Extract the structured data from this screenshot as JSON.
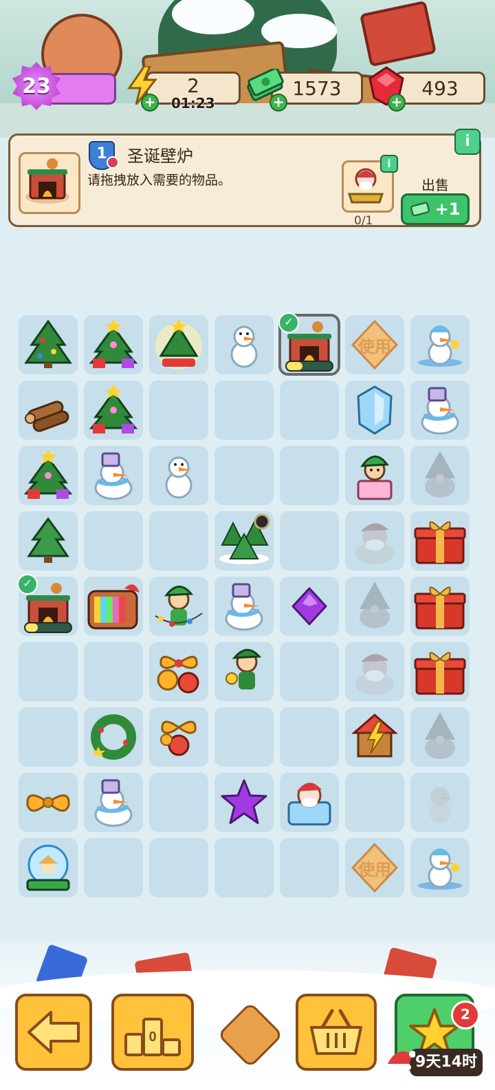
{
  "hud": {
    "level": "23",
    "energy": "2",
    "energy_timer": "01:23",
    "cash": "1573",
    "gems": "493"
  },
  "info_panel": {
    "rank": "1",
    "title": "圣诞壁炉",
    "description": "请拖拽放入需要的物品。",
    "requirement_count": "0/1",
    "sell_label": "出售",
    "sell_value": "+1",
    "info_glyph": "i"
  },
  "board": {
    "cols": 7,
    "rows": 9,
    "cells": [
      [
        "tree-decorated",
        "tree-star-gifts",
        "tree-star-glowing",
        "snowman-small",
        "fireplace-building",
        "use-token",
        "snowman-ski"
      ],
      [
        "logs",
        "tree-star-gifts",
        "empty",
        "empty",
        "empty",
        "ice-crystal",
        "snowman-bucket"
      ],
      [
        "tree-star-gifts",
        "snowman-bucket",
        "snowman-small",
        "empty",
        "empty",
        "elf-gift",
        "gnome-ghost"
      ],
      [
        "pine-tree",
        "empty",
        "empty",
        "snowy-pines",
        "empty",
        "santa-ghost",
        "gift-box-red"
      ],
      [
        "fireplace-building",
        "retro-tv",
        "elf-lights",
        "snowman-bucket",
        "purple-gem",
        "gnome-ghost",
        "gift-box-red"
      ],
      [
        "empty",
        "empty",
        "bells-bow",
        "elf-bell",
        "empty",
        "santa-ghost",
        "gift-box-red"
      ],
      [
        "empty",
        "wreath",
        "bells-bow-small",
        "empty",
        "empty",
        "energy-gingerbread-house",
        "gnome-ghost"
      ],
      [
        "bow-orange",
        "snowman-bucket",
        "empty",
        "purple-star",
        "santa-ice",
        "empty",
        "snowman-ghost"
      ],
      [
        "snow-globe",
        "empty",
        "empty",
        "empty",
        "empty",
        "use-token",
        "snowman-ski"
      ]
    ],
    "use_label": "使用",
    "check_glyph": "✓",
    "building_progress": [
      0.35,
      0.28
    ]
  },
  "bottom_bar": {
    "back_icon": "arrow-left-icon",
    "leaderboard_icon": "podium-icon",
    "leaderboard_label": "0",
    "shop_icon": "basket-icon",
    "event_icon": "star-icon",
    "event_badge": "2",
    "event_timer": "9天14时"
  },
  "colors": {
    "cell": "#c6dfeb",
    "button_yellow": "#ffc23a",
    "button_green": "#4fcf6a",
    "panel": "#f6ecd8"
  }
}
